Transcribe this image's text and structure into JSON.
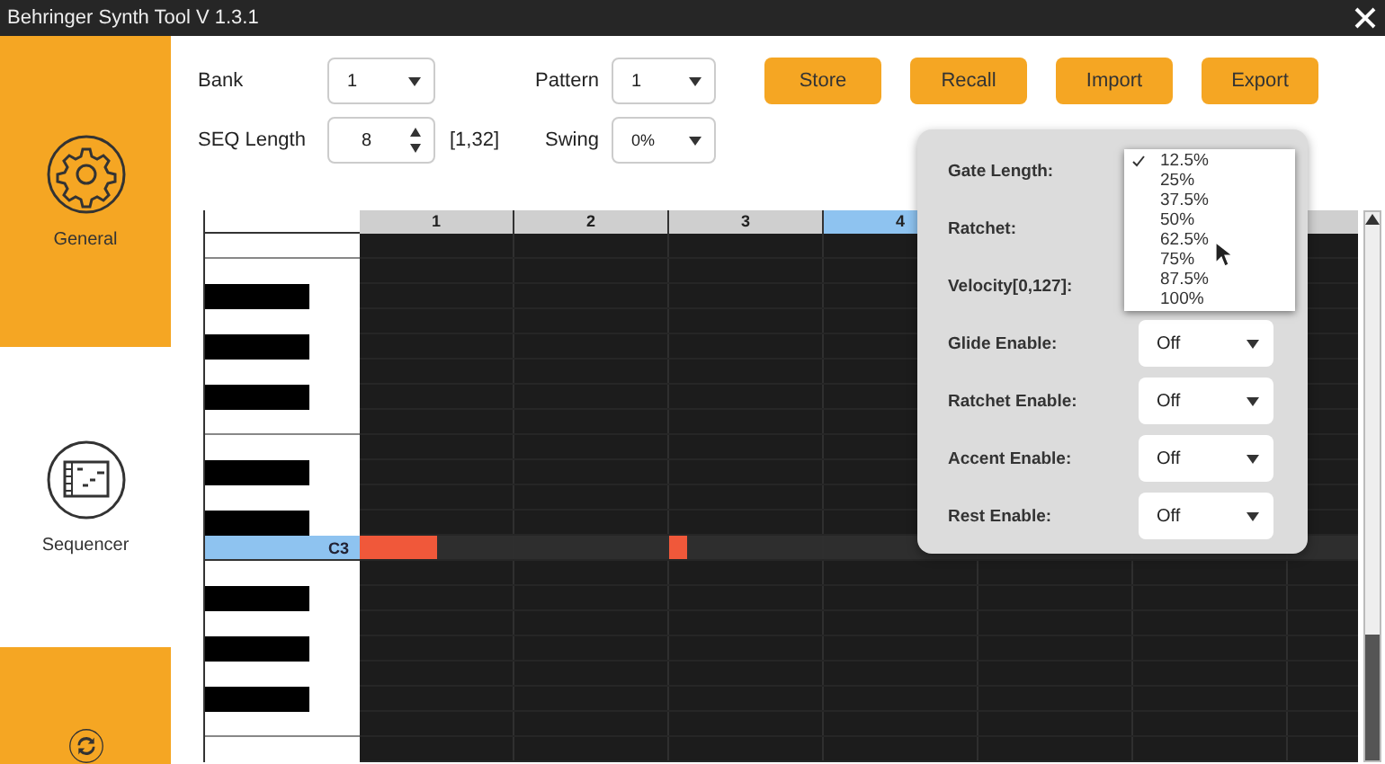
{
  "window": {
    "title": "Behringer Synth Tool V 1.3.1"
  },
  "sidebar": {
    "items": [
      {
        "label": "General",
        "kind": "general",
        "selected": false
      },
      {
        "label": "Sequencer",
        "kind": "sequencer",
        "selected": true
      },
      {
        "kind": "sync",
        "selected": false
      }
    ]
  },
  "controls": {
    "bank": {
      "label": "Bank",
      "value": "1"
    },
    "pattern": {
      "label": "Pattern",
      "value": "1"
    },
    "seq_length": {
      "label": "SEQ Length",
      "value": "8",
      "range": "[1,32]"
    },
    "swing": {
      "label": "Swing",
      "value": "0%"
    }
  },
  "buttons": [
    "Store",
    "Recall",
    "Import",
    "Export"
  ],
  "piano_roll": {
    "steps": [
      {
        "label": "1",
        "selected": false
      },
      {
        "label": "2",
        "selected": false
      },
      {
        "label": "3",
        "selected": false
      },
      {
        "label": "4",
        "selected": true
      }
    ],
    "selected_key": "C3",
    "note_row": [
      {
        "kind": "long"
      },
      {
        "kind": "empty"
      },
      {
        "kind": "short"
      },
      {
        "kind": "empty"
      }
    ]
  },
  "step_popup": {
    "params": [
      {
        "label": "Gate Length:",
        "kind": "open"
      },
      {
        "label": "Ratchet:",
        "kind": "covered"
      },
      {
        "label": "Velocity[0,127]:",
        "kind": "covered"
      },
      {
        "label": "Glide Enable:",
        "kind": "select",
        "value": "Off"
      },
      {
        "label": "Ratchet Enable:",
        "kind": "select",
        "value": "Off"
      },
      {
        "label": "Accent Enable:",
        "kind": "select",
        "value": "Off"
      },
      {
        "label": "Rest Enable:",
        "kind": "select",
        "value": "Off"
      }
    ],
    "open_list": [
      {
        "label": "12.5%",
        "selected": true
      },
      {
        "label": "25%",
        "selected": false
      },
      {
        "label": "37.5%",
        "selected": false
      },
      {
        "label": "50%",
        "selected": false
      },
      {
        "label": "62.5%",
        "selected": false
      },
      {
        "label": "75%",
        "selected": false
      },
      {
        "label": "87.5%",
        "selected": false
      },
      {
        "label": "100%",
        "selected": false
      }
    ]
  }
}
